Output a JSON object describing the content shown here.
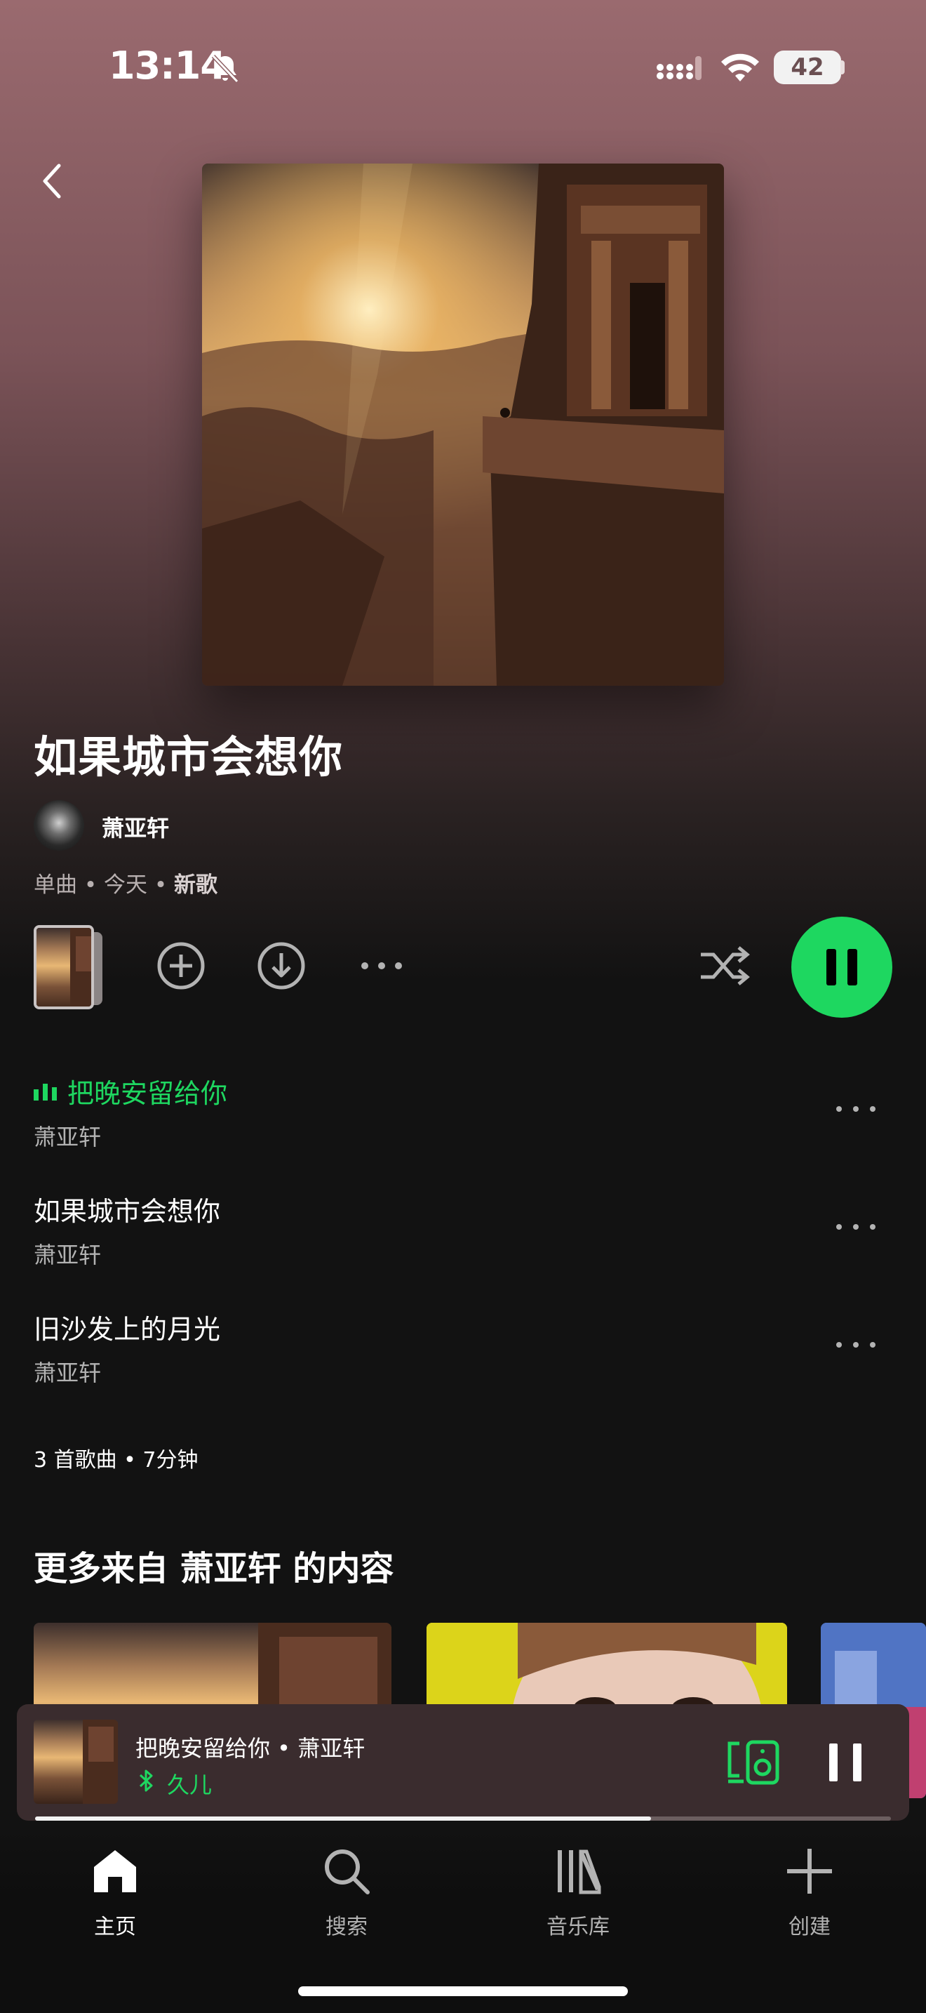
{
  "status_bar": {
    "time": "13:14",
    "battery": "42"
  },
  "release": {
    "title": "如果城市会想你",
    "artist": "萧亚轩",
    "type": "单曲",
    "date": "今天",
    "tag": "新歌"
  },
  "tracks": [
    {
      "title": "把晚安留给你",
      "artist": "萧亚轩",
      "playing": true
    },
    {
      "title": "如果城市会想你",
      "artist": "萧亚轩",
      "playing": false
    },
    {
      "title": "旧沙发上的月光",
      "artist": "萧亚轩",
      "playing": false
    }
  ],
  "summary": "3 首歌曲 • 7分钟",
  "more_section": {
    "title": "更多来自 萧亚轩 的内容"
  },
  "mini_player": {
    "track": "把晚安留给你 • 萧亚轩",
    "device": "久儿",
    "progress": 0.72
  },
  "nav": [
    {
      "label": "主页",
      "icon": "home-icon",
      "active": true
    },
    {
      "label": "搜索",
      "icon": "search-icon",
      "active": false
    },
    {
      "label": "音乐库",
      "icon": "library-icon",
      "active": false
    },
    {
      "label": "创建",
      "icon": "plus-icon",
      "active": false
    }
  ],
  "colors": {
    "accent": "#1ed760",
    "background": "#121212"
  }
}
